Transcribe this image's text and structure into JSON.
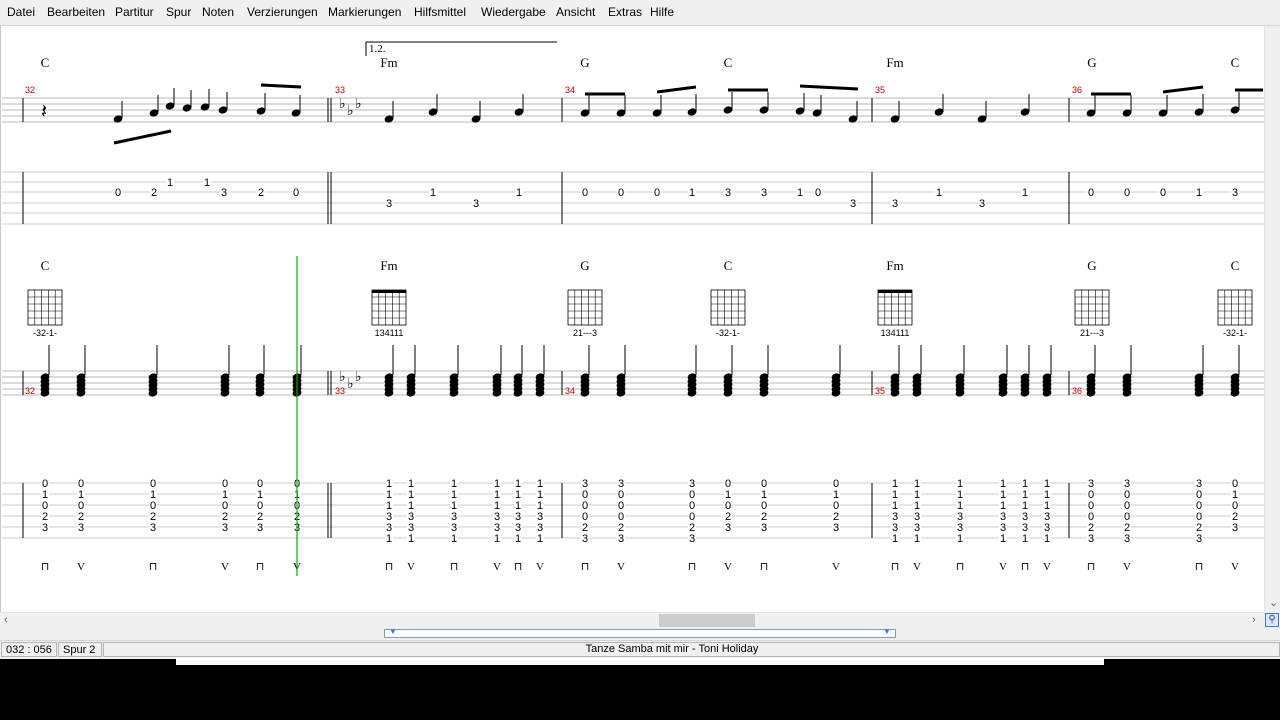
{
  "menu": [
    "Datei",
    "Bearbeiten",
    "Partitur",
    "Spur",
    "Noten",
    "Verzierungen",
    "Markierungen",
    "Hilfsmittel",
    "Wiedergabe",
    "Ansicht",
    "Extras",
    "Hilfe"
  ],
  "score": {
    "volta": "1.2.",
    "system1": {
      "chords": [
        "C",
        "Fm",
        "G",
        "C",
        "Fm",
        "G",
        "C"
      ],
      "measures": [
        "32",
        "33",
        "34",
        "35",
        "36"
      ],
      "tab": {
        "m32": [
          [
            "0",
            "",
            "2",
            "1",
            "1",
            "3",
            "2",
            "0"
          ]
        ],
        "m33": [
          "3",
          "1",
          "3",
          "1"
        ],
        "m34": [
          "0",
          "0",
          "0",
          "1",
          "3",
          "3",
          "1",
          "0",
          "3"
        ],
        "m35": [
          "3",
          "1",
          "3",
          "1"
        ],
        "m36": [
          "0",
          "0",
          "0",
          "1",
          "3"
        ]
      }
    },
    "system2": {
      "chords": [
        "C",
        "Fm",
        "G",
        "C",
        "Fm",
        "G",
        "C"
      ],
      "fingerings": [
        "-32-1-",
        "134111",
        "21---3",
        "-32-1-",
        "134111",
        "21---3",
        "-32-1-"
      ],
      "measures": [
        "32",
        "33",
        "34",
        "35",
        "36"
      ],
      "voicings": {
        "C": [
          "0",
          "1",
          "0",
          "2",
          "3",
          ""
        ],
        "Fm": [
          "1",
          "1",
          "1",
          "3",
          "3",
          "1"
        ],
        "G": [
          "3",
          "0",
          "0",
          "0",
          "2",
          "3"
        ]
      },
      "strokes": {
        "down": "⊓",
        "up": "V"
      }
    }
  },
  "status": {
    "position": "032 : 056",
    "track": "Spur 2",
    "title": "Tanze Samba mit mir - Toni Holiday"
  },
  "colors": {
    "measure_number": "#c00000",
    "cursor": "#00b000",
    "menubar": "#f0f0f0",
    "scrollbar_thumb": "#cdcdcd"
  },
  "icons": [
    "zoom-icon",
    "scroll-left-arrow",
    "scroll-right-arrow",
    "scroll-down-arrow"
  ]
}
